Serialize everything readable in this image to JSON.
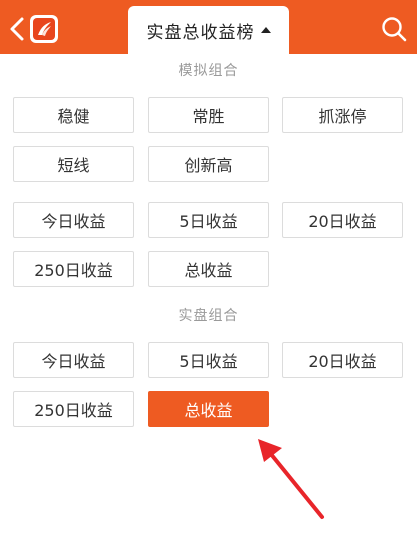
{
  "header": {
    "title": "实盘总收益榜"
  },
  "simulated": {
    "label": "模拟组合",
    "styles": [
      "稳健",
      "常胜",
      "抓涨停",
      "短线",
      "创新高"
    ],
    "periods": [
      "今日收益",
      "5日收益",
      "20日收益",
      "250日收益",
      "总收益"
    ]
  },
  "real": {
    "label": "实盘组合",
    "periods": [
      "今日收益",
      "5日收益",
      "20日收益",
      "250日收益",
      "总收益"
    ],
    "selected": "总收益"
  },
  "colors": {
    "accent": "#ee5b22",
    "annotation_arrow": "#e8252a"
  }
}
